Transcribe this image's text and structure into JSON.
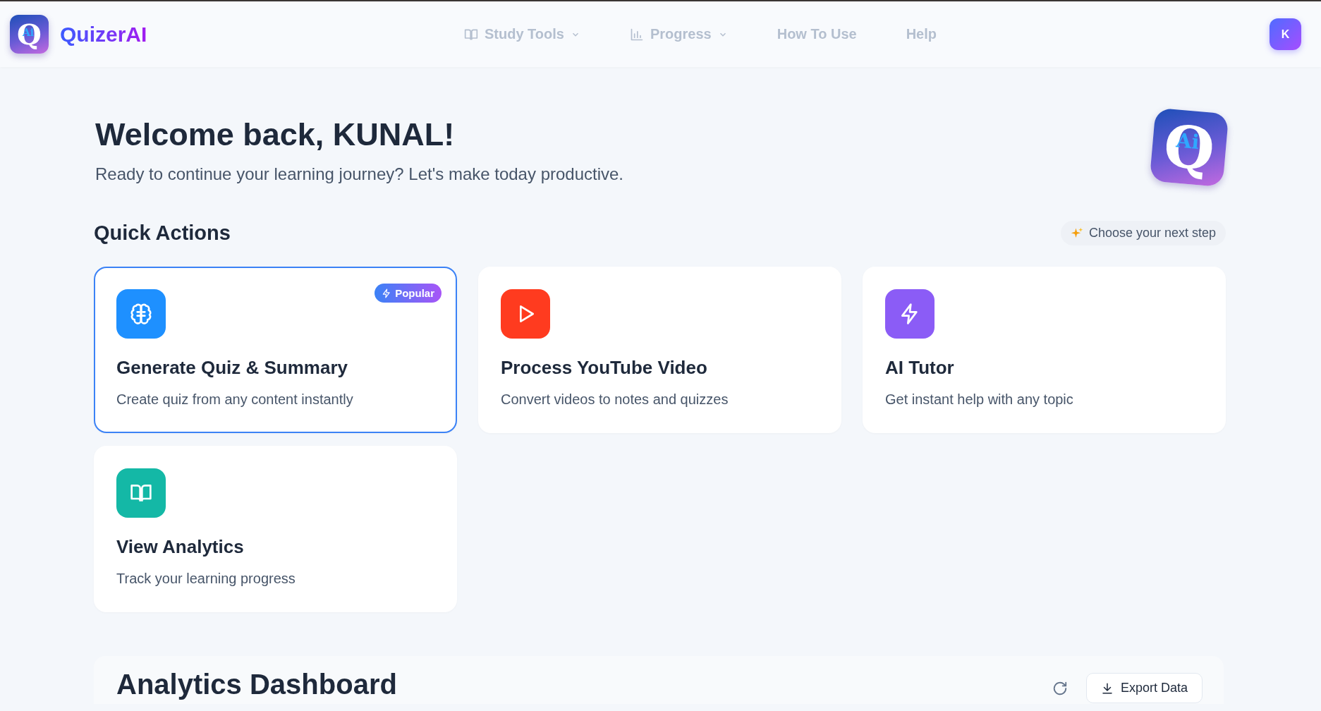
{
  "header": {
    "brand": {
      "name": "QuizerAI",
      "logo_letter": "Q",
      "logo_sub": "Ai"
    },
    "nav": [
      {
        "label": "Study Tools",
        "kind": "book",
        "dropdown": true
      },
      {
        "label": "Progress",
        "kind": "chart",
        "dropdown": true
      },
      {
        "label": "How To Use",
        "kind": "plain",
        "dropdown": false
      },
      {
        "label": "Help",
        "kind": "plain",
        "dropdown": false
      }
    ],
    "avatar": "K"
  },
  "welcome": {
    "title": "Welcome back, KUNAL!",
    "subtitle": "Ready to continue your learning journey? Let's make today productive.",
    "logo_letter": "Q",
    "logo_sub": "Ai"
  },
  "quick_actions": {
    "title": "Quick Actions",
    "chip": "Choose your next step",
    "cards": [
      {
        "title": "Generate Quiz & Summary",
        "description": "Create quiz from any content instantly",
        "kind": "brain",
        "color": "#1e90ff",
        "selected": true,
        "badge": "Popular"
      },
      {
        "title": "Process YouTube Video",
        "description": "Convert videos to notes and quizzes",
        "kind": "play",
        "color": "#ff3b1f",
        "selected": false
      },
      {
        "title": "AI Tutor",
        "description": "Get instant help with any topic",
        "kind": "bolt",
        "color": "#8b5cf6",
        "selected": false
      },
      {
        "title": "View Analytics",
        "description": "Track your learning progress",
        "kind": "book",
        "color": "#14b8a6",
        "selected": false
      }
    ]
  },
  "analytics": {
    "title": "Analytics Dashboard",
    "export_button": "Export Data"
  }
}
